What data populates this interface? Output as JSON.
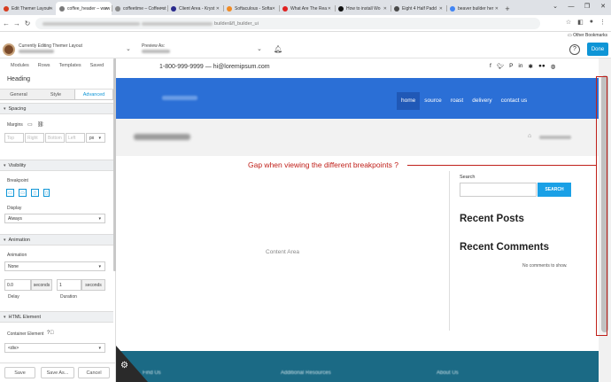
{
  "browser": {
    "tabs": [
      {
        "label": "Edit Themer Layout ‹ ",
        "color": "#d63c1e"
      },
      {
        "label": "coffee_header – www",
        "color": "#7a7a7a"
      },
      {
        "label": "coffeetime – Coffee st",
        "color": "#888"
      },
      {
        "label": "Client Area - Kryst",
        "color": "#2a2a8c"
      },
      {
        "label": "Softaculous - Softa",
        "color": "#f08a24"
      },
      {
        "label": "What Are The Rea",
        "color": "#e02020"
      },
      {
        "label": "How to install Wo",
        "color": "#111"
      },
      {
        "label": "Eight 4 Half Padd",
        "color": "#4a4a4a"
      },
      {
        "label": "beaver builder her",
        "color": "#4285f4"
      }
    ],
    "new_tab": "+",
    "url_visible": "builder&fl_builder_ui",
    "other_bookmarks": "Other Bookmarks"
  },
  "builder_bar": {
    "title": "Currently Editing Themer Layout",
    "preview_label": "Preview As:",
    "help": "?",
    "done": "Done"
  },
  "panel": {
    "tabs": [
      "Modules",
      "Rows",
      "Templates",
      "Saved"
    ],
    "heading": "Heading",
    "subtabs": [
      "General",
      "Style",
      "Advanced"
    ],
    "active_subtab": "Advanced",
    "sections": {
      "spacing": "Spacing",
      "visibility": "Visibility",
      "animation": "Animation",
      "html_element": "HTML Element"
    },
    "margins_label": "Margins",
    "margin_unit": "px",
    "margin_placeholders": [
      "Top",
      "Right",
      "Bottom",
      "Left"
    ],
    "breakpoint_label": "Breakpoint",
    "display_label": "Display",
    "display_value": "Always",
    "animation_label": "Animation",
    "animation_value": "None",
    "delay_value": "0.0",
    "delay_unit": "seconds",
    "delay_label": "Delay",
    "duration_value": "1",
    "duration_unit": "seconds",
    "duration_label": "Duration",
    "container_label": "Container Element",
    "container_value": "<div>",
    "buttons": {
      "save": "Save",
      "save_as": "Save As...",
      "cancel": "Cancel"
    }
  },
  "site": {
    "topbar_contact": "1-800-999-9999 — hi@loremipsum.com",
    "social_icons": [
      "facebook-icon",
      "twitter-icon",
      "pinterest-icon",
      "linkedin-icon",
      "yelp-icon",
      "flickr-icon",
      "dribbble-icon"
    ],
    "menu": [
      "home",
      "source",
      "roast",
      "delivery",
      "contact us"
    ],
    "active_menu": "home",
    "content_area": "Content Area",
    "search_label": "Search",
    "search_button": "SEARCH",
    "recent_posts": "Recent Posts",
    "recent_comments": "Recent Comments",
    "no_comments": "No comments to show.",
    "footer_cols": [
      "Find Us",
      "Additional Resources",
      "About Us"
    ]
  },
  "annotation": {
    "text": "Gap when viewing the different breakpoints ?",
    "color": "#c0201a"
  },
  "colors": {
    "header_blue": "#2b6fd6",
    "builder_accent": "#0e95d6",
    "footer": "#1b6a85"
  }
}
